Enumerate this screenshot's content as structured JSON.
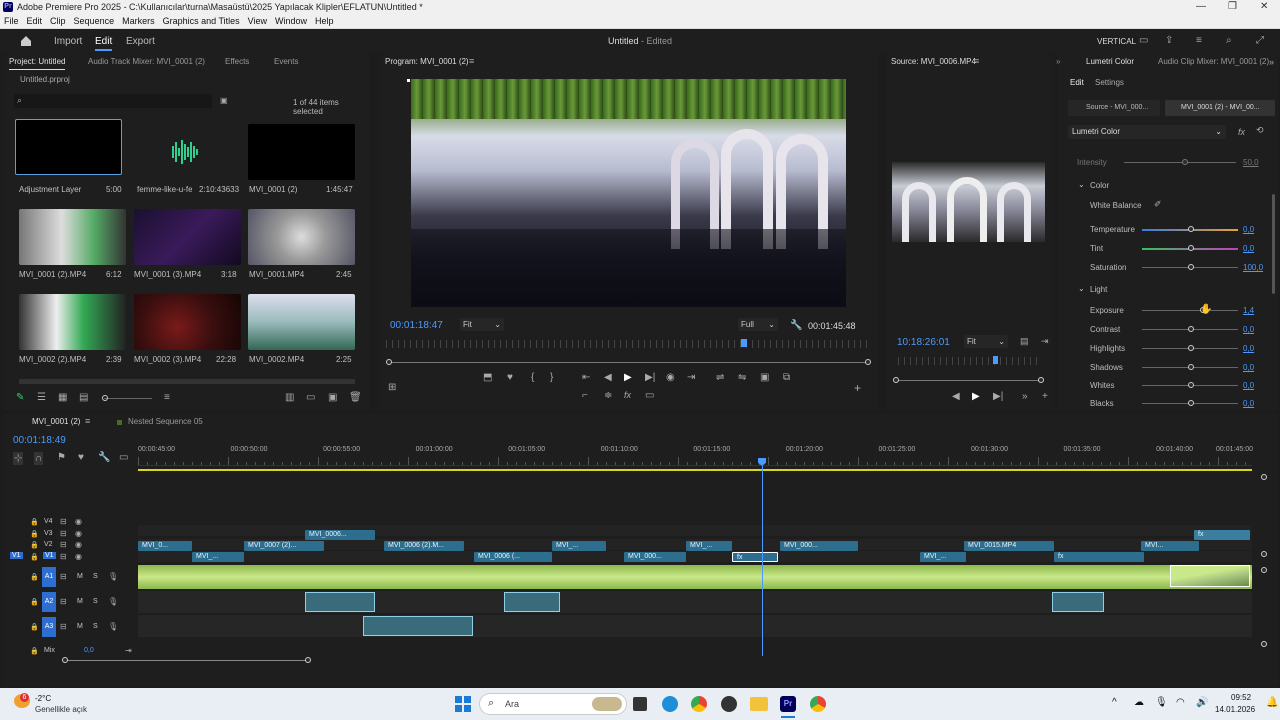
{
  "window": {
    "title": "Adobe Premiere Pro 2025 - C:\\Kullanıcılar\\turna\\Masaüstü\\2025 Yapılacak Klipler\\EFLATUN\\Untitled *",
    "minimize": "—",
    "restore": "❐",
    "close": "✕"
  },
  "menu": [
    "File",
    "Edit",
    "Clip",
    "Sequence",
    "Markers",
    "Graphics and Titles",
    "View",
    "Window",
    "Help"
  ],
  "header": {
    "import": "Import",
    "edit": "Edit",
    "export": "Export",
    "center_title": "Untitled",
    "center_status": " - Edited",
    "workspace": "VERTICAL"
  },
  "project": {
    "tabs": [
      "Project: Untitled",
      "Audio Track Mixer: MVI_0001 (2)",
      "Effects",
      "Events"
    ],
    "file": "Untitled.prproj",
    "selection": "1 of 44 items selected",
    "items": [
      {
        "name": "Adjustment Layer",
        "dur": "5:00"
      },
      {
        "name": "femme-like-u-fea...",
        "dur": "2:10:43633"
      },
      {
        "name": "MVI_0001 (2)",
        "dur": "1:45:47"
      },
      {
        "name": "MVI_0001 (2).MP4",
        "dur": "6:12"
      },
      {
        "name": "MVI_0001 (3).MP4",
        "dur": "3:18"
      },
      {
        "name": "MVI_0001.MP4",
        "dur": "2:45"
      },
      {
        "name": "MVI_0002 (2).MP4",
        "dur": "2:39"
      },
      {
        "name": "MVI_0002 (3).MP4",
        "dur": "22:28"
      },
      {
        "name": "MVI_0002.MP4",
        "dur": "2:25"
      }
    ]
  },
  "program": {
    "title": "Program: MVI_0001 (2)",
    "timecode": "00:01:18:47",
    "fit": "Fit",
    "quality": "Full",
    "duration": "00:01:45:48"
  },
  "source": {
    "title": "Source: MVI_0006.MP4",
    "timecode": "10:18:26:01",
    "fit": "Fit"
  },
  "lumetri": {
    "tabs": [
      "Lumetri Color",
      "Audio Clip Mixer: MVI_0001 (2)"
    ],
    "edit_tab": "Edit",
    "settings_tab": "Settings",
    "source_chip": "Source - MVI_000...",
    "seq_chip": "MVI_0001 (2) - MVI_00...",
    "effect": "Lumetri Color",
    "intensity_label": "Intensity",
    "intensity": "50,0",
    "color_section": "Color",
    "white_balance": "White Balance",
    "color_rows": [
      {
        "label": "Temperature",
        "value": "0,0"
      },
      {
        "label": "Tint",
        "value": "0,0"
      },
      {
        "label": "Saturation",
        "value": "100,0"
      }
    ],
    "light_section": "Light",
    "light_rows": [
      {
        "label": "Exposure",
        "value": "1,4"
      },
      {
        "label": "Contrast",
        "value": "0,0"
      },
      {
        "label": "Highlights",
        "value": "0,0"
      },
      {
        "label": "Shadows",
        "value": "0,0"
      },
      {
        "label": "Whites",
        "value": "0,0"
      },
      {
        "label": "Blacks",
        "value": "0,0"
      }
    ]
  },
  "timeline": {
    "tab": "MVI_0001 (2)",
    "tab2": "Nested Sequence 05",
    "timecode": "00:01:18:49",
    "ruler": [
      "00:00:45:00",
      "00:00:50:00",
      "00:00:55:00",
      "00:01:00:00",
      "00:01:05:00",
      "00:01:10:00",
      "00:01:15:00",
      "00:01:20:00",
      "00:01:25:00",
      "00:01:30:00",
      "00:01:35:00",
      "00:01:40:00",
      "00:01:45:00"
    ],
    "video_tracks": [
      "V4",
      "V3",
      "V2",
      "V1"
    ],
    "audio_tracks": [
      "A1",
      "A2",
      "A3"
    ],
    "mix": "Mix",
    "mix_value": "0,0",
    "track_m": "M",
    "track_s": "S",
    "clips": [
      "MVI_0...",
      "MVI_0007 (2)...",
      "MVI_0006...",
      "MVI_0006 (2).M...",
      "MVI_...",
      "MVI_...",
      "MVI_0006 (...",
      "MVI_000...",
      "MVI_...",
      "MVI_000...",
      "MVI_0015.MP4",
      "MVI...",
      "MVI_..."
    ],
    "fx": "fx"
  },
  "taskbar": {
    "temp": "-2°C",
    "weather": "Genellikle açık",
    "search": "Ara",
    "time": "09:52",
    "date": "14.01.2026"
  }
}
